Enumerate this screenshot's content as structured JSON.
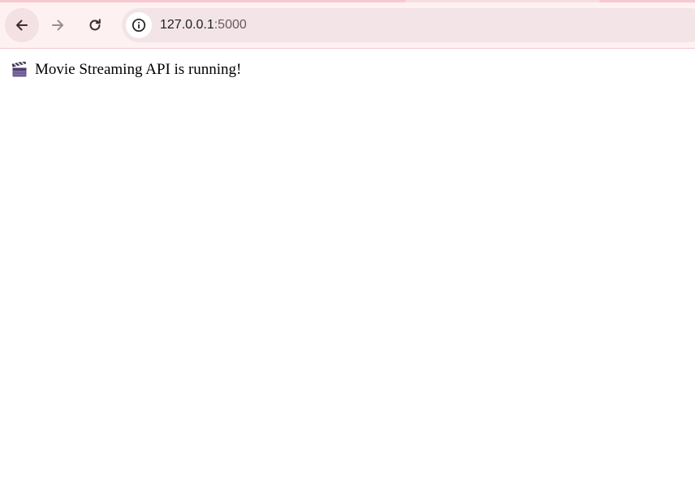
{
  "browser": {
    "url_host": "127.0.0.1",
    "url_port": ":5000",
    "icons": {
      "back": "arrow-left-icon",
      "forward": "arrow-right-icon",
      "reload": "reload-icon",
      "site_info": "info-circle-icon"
    },
    "colors": {
      "toolbar_bg": "#fdf1f2",
      "omnibox_bg": "#f2e4e7",
      "accent": "#f5c9cf"
    }
  },
  "page": {
    "icon": "clapper-board-icon",
    "message": "Movie Streaming API is running!"
  }
}
